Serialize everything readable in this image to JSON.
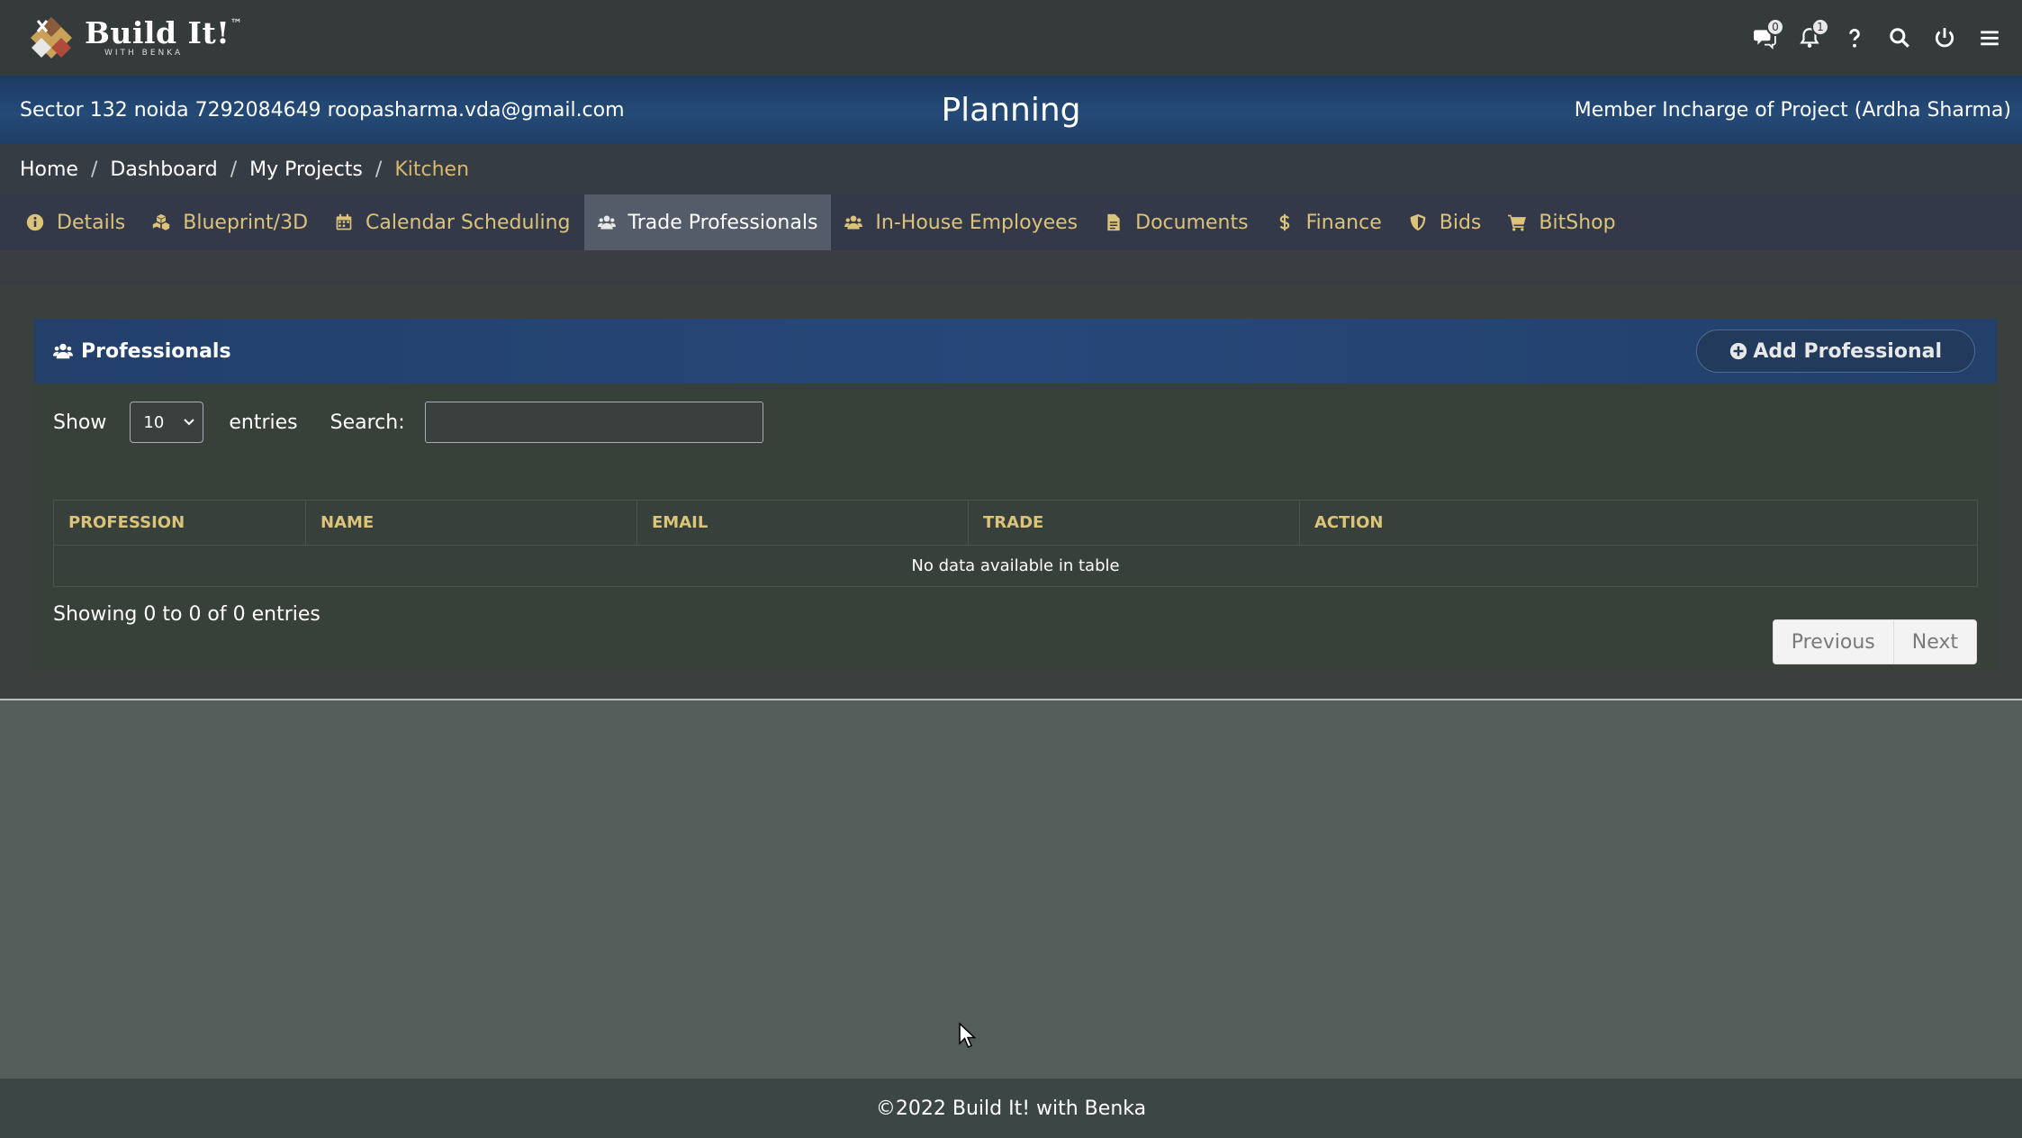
{
  "app": {
    "logo_title": "Build It!",
    "logo_tm": "™",
    "logo_sub": "WITH BENKA"
  },
  "top_icons": {
    "chat_badge": "0",
    "bell_badge": "1",
    "icons": [
      "chat-icon",
      "bell-icon",
      "help-icon",
      "search-icon",
      "power-icon",
      "menu-icon"
    ]
  },
  "project": {
    "info": "Sector 132 noida 7292084649 roopasharma.vda@gmail.com",
    "title": "Planning",
    "member": "Member Incharge of Project (Ardha Sharma)"
  },
  "breadcrumb": {
    "items": [
      "Home",
      "Dashboard",
      "My Projects"
    ],
    "separator": "/",
    "active": "Kitchen"
  },
  "tabs": [
    {
      "label": "Details",
      "icon": "info-icon"
    },
    {
      "label": "Blueprint/3D",
      "icon": "cubes-icon"
    },
    {
      "label": "Calendar Scheduling",
      "icon": "calendar-icon"
    },
    {
      "label": "Trade Professionals",
      "icon": "users-icon",
      "active": true
    },
    {
      "label": "In-House Employees",
      "icon": "users-icon"
    },
    {
      "label": "Documents",
      "icon": "file-icon"
    },
    {
      "label": "Finance",
      "icon": "dollar-icon"
    },
    {
      "label": "Bids",
      "icon": "shield-icon"
    },
    {
      "label": "BitShop",
      "icon": "cart-icon"
    }
  ],
  "panel": {
    "title": "Professionals",
    "add_button": "Add Professional",
    "show_label": "Show",
    "page_size": "10",
    "entries_label": "entries",
    "search_label": "Search:",
    "search_value": "",
    "columns": [
      "PROFESSION",
      "NAME",
      "EMAIL",
      "TRADE",
      "ACTION"
    ],
    "empty_message": "No data available in table",
    "showing": "Showing 0 to 0 of 0 entries",
    "prev": "Previous",
    "next": "Next"
  },
  "footer": {
    "text": "©2022 Build It! with Benka"
  },
  "colors": {
    "accent_gold": "#dcc37a",
    "header_blue": "#244a77",
    "active_tab": "#545c6a"
  }
}
